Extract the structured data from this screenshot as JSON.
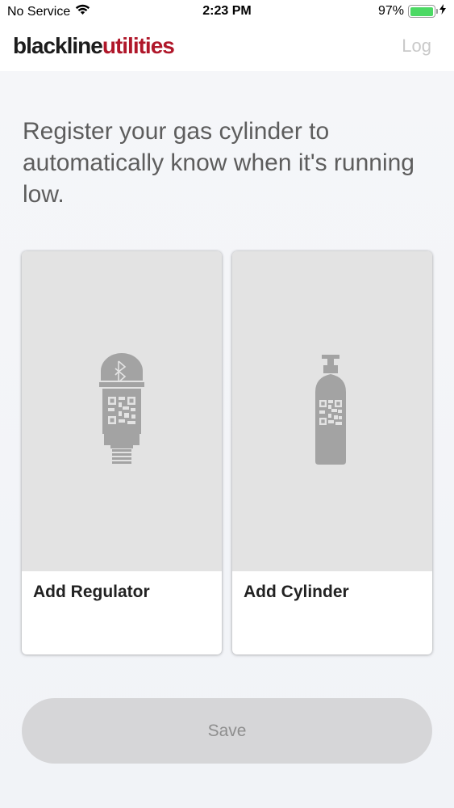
{
  "status_bar": {
    "carrier": "No Service",
    "time": "2:23 PM",
    "battery_percent": "97%",
    "battery_level": 0.97,
    "icons": [
      "wifi-icon",
      "battery-icon",
      "charging-bolt-icon"
    ]
  },
  "header": {
    "logo_part1": "blackline",
    "logo_part2": "utilities",
    "log_label": "Log",
    "colors": {
      "logo_dark": "#1c1c1c",
      "logo_red": "#b0172a"
    }
  },
  "intro": {
    "text": "Register your gas cylinder to automatically know when it's running low."
  },
  "cards": [
    {
      "label": "Add Regulator",
      "icon": "regulator-qr-icon"
    },
    {
      "label": "Add Cylinder",
      "icon": "cylinder-qr-icon"
    }
  ],
  "save_button": {
    "label": "Save",
    "color": "#d6d6d8"
  }
}
